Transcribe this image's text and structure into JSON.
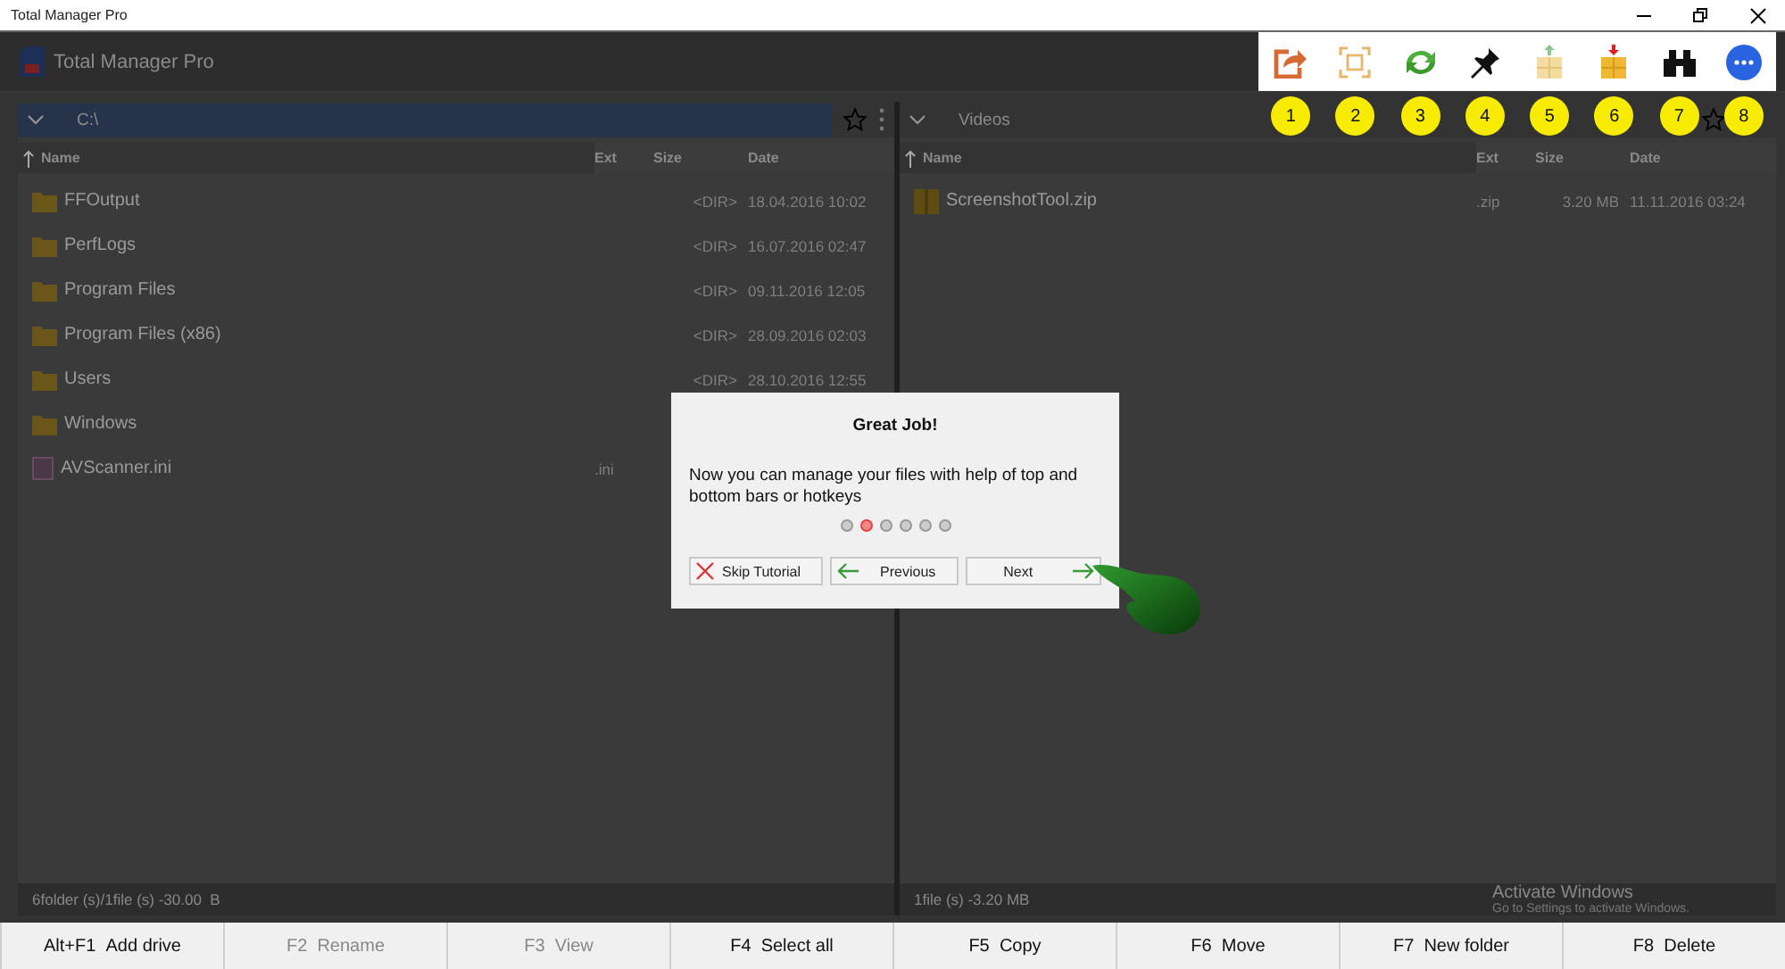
{
  "window": {
    "title": "Total Manager Pro"
  },
  "app": {
    "title": "Total Manager Pro"
  },
  "toolbar": [
    {
      "kind": "share",
      "number": "1"
    },
    {
      "kind": "fullscreen",
      "number": "2"
    },
    {
      "kind": "refresh",
      "number": "3"
    },
    {
      "kind": "pin",
      "number": "4"
    },
    {
      "kind": "pack",
      "number": "5"
    },
    {
      "kind": "unpack",
      "number": "6"
    },
    {
      "kind": "binoculars",
      "number": "7"
    },
    {
      "kind": "more",
      "number": "8"
    }
  ],
  "panels": [
    {
      "path": "C:\\",
      "active": true,
      "columns": [
        "Name",
        "Ext",
        "Size",
        "Date"
      ],
      "rows": [
        {
          "kind": "folder",
          "name": "FFOutput",
          "size": "<DIR>",
          "date": "18.04.2016 10:02"
        },
        {
          "kind": "folder",
          "name": "PerfLogs",
          "size": "<DIR>",
          "date": "16.07.2016 02:47"
        },
        {
          "kind": "folder",
          "name": "Program Files",
          "size": "<DIR>",
          "date": "09.11.2016 12:05"
        },
        {
          "kind": "folder",
          "name": "Program Files (x86)",
          "size": "<DIR>",
          "date": "28.09.2016 02:03"
        },
        {
          "kind": "folder",
          "name": "Users",
          "size": "<DIR>",
          "date": "28.10.2016 12:55"
        },
        {
          "kind": "folder",
          "name": "Windows"
        },
        {
          "kind": "file",
          "name": "AVScanner.ini",
          "ext": ".ini"
        }
      ],
      "status": "6folder (s)/1file (s) -30.00  B"
    },
    {
      "path": "Videos",
      "active": false,
      "columns": [
        "Name",
        "Ext",
        "Size",
        "Date"
      ],
      "rows": [
        {
          "kind": "archive",
          "name": "ScreenshotTool.zip",
          "ext": ".zip",
          "size": "3.20 MB",
          "date": "11.11.2016 03:24"
        }
      ],
      "status": "1file (s) -3.20 MB"
    }
  ],
  "dialog": {
    "title": "Great Job!",
    "message": "Now you can manage your files with help of top and bottom bars or hotkeys",
    "dots": [
      {
        "selected": false
      },
      {
        "selected": true
      },
      {
        "selected": false
      },
      {
        "selected": false
      },
      {
        "selected": false
      },
      {
        "selected": false
      }
    ],
    "buttons": [
      {
        "kind": "skip",
        "label": "Skip Tutorial"
      },
      {
        "kind": "previous",
        "label": "Previous"
      },
      {
        "kind": "next",
        "label": "Next"
      }
    ]
  },
  "activation": {
    "title": "Activate Windows",
    "hint": "Go to Settings to activate Windows."
  },
  "bottom_bar": [
    {
      "key": "Alt+F1",
      "label": "Add drive",
      "disabled": false
    },
    {
      "key": "F2",
      "label": "Rename",
      "disabled": true
    },
    {
      "key": "F3",
      "label": "View",
      "disabled": true
    },
    {
      "key": "F4",
      "label": "Select all",
      "disabled": false
    },
    {
      "key": "F5",
      "label": "Copy",
      "disabled": false
    },
    {
      "key": "F6",
      "label": "Move",
      "disabled": false
    },
    {
      "key": "F7",
      "label": "New folder",
      "disabled": false
    },
    {
      "key": "F8",
      "label": "Delete",
      "disabled": false
    }
  ]
}
